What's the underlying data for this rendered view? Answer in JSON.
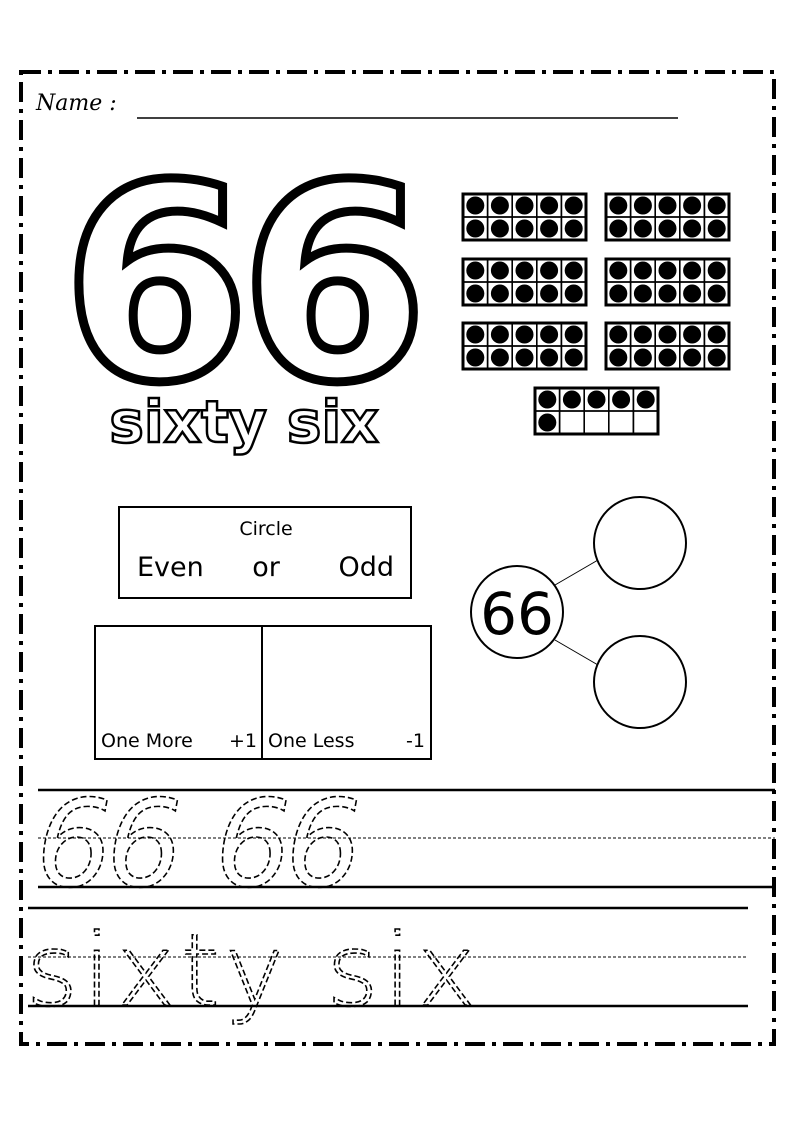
{
  "header": {
    "name_label": "Name :"
  },
  "number": {
    "numeral": "66",
    "word": "sixty six"
  },
  "ten_frames": {
    "filled_counts": [
      10,
      10,
      10,
      10,
      10,
      10,
      6
    ],
    "cells_per_frame": 10
  },
  "even_odd": {
    "instruction": "Circle",
    "even": "Even",
    "or": "or",
    "odd": "Odd"
  },
  "number_bond": {
    "whole": "66",
    "parts": [
      "",
      ""
    ]
  },
  "more_less": {
    "one_more": "One More",
    "plus": "+1",
    "one_less": "One Less",
    "minus": "-1"
  },
  "tracing": {
    "numerals": [
      "66",
      "66"
    ],
    "word": "sixty six"
  }
}
